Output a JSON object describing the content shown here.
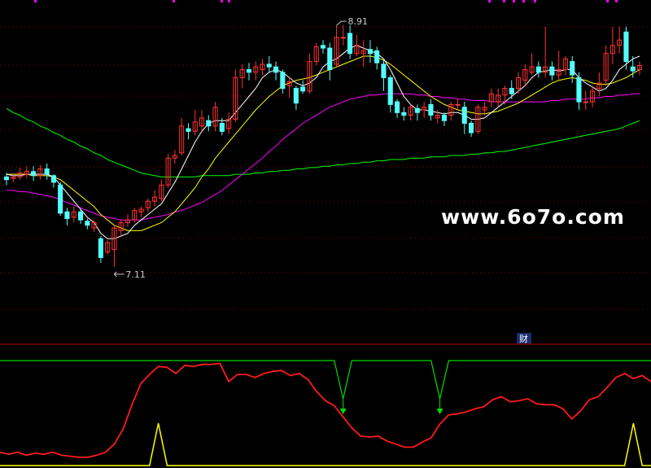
{
  "chart_data": {
    "type": "candlestick",
    "price_range": [
      6.6,
      9.05
    ],
    "high_label": "8.91",
    "low_label": "7.11",
    "watermark": "www.6o7o.com",
    "badge": "财",
    "colors": {
      "background": "#000000",
      "up": "#ff3232",
      "down": "#54ffff",
      "ma_short": "#ffffff",
      "ma_mid": "#ffff00",
      "ma_long": "#ff00ff",
      "ma_longest": "#00ff00",
      "grid": "#8b0000",
      "divider": "#c00000",
      "osc_red": "#ff1a1a",
      "osc_green": "#00dd00",
      "osc_yellow": "#ffff00"
    },
    "candles": [
      [
        7.78,
        7.76,
        7.72,
        7.81
      ],
      [
        7.77,
        7.78,
        7.74,
        7.81
      ],
      [
        7.78,
        7.81,
        7.76,
        7.85
      ],
      [
        7.8,
        7.82,
        7.77,
        7.86
      ],
      [
        7.82,
        7.79,
        7.75,
        7.86
      ],
      [
        7.79,
        7.84,
        7.76,
        7.87
      ],
      [
        7.84,
        7.8,
        7.76,
        7.88
      ],
      [
        7.79,
        7.74,
        7.7,
        7.8
      ],
      [
        7.72,
        7.51,
        7.49,
        7.74
      ],
      [
        7.52,
        7.47,
        7.42,
        7.55
      ],
      [
        7.48,
        7.52,
        7.44,
        7.56
      ],
      [
        7.52,
        7.46,
        7.43,
        7.54
      ],
      [
        7.45,
        7.42,
        7.39,
        7.47
      ],
      [
        7.4,
        7.44,
        7.37,
        7.46
      ],
      [
        7.32,
        7.18,
        7.14,
        7.34
      ],
      [
        7.22,
        7.29,
        7.2,
        7.31
      ],
      [
        7.24,
        7.4,
        7.11,
        7.42
      ],
      [
        7.38,
        7.44,
        7.34,
        7.46
      ],
      [
        7.44,
        7.46,
        7.41,
        7.5
      ],
      [
        7.46,
        7.53,
        7.44,
        7.55
      ],
      [
        7.52,
        7.54,
        7.48,
        7.56
      ],
      [
        7.55,
        7.6,
        7.52,
        7.62
      ],
      [
        7.6,
        7.63,
        7.56,
        7.68
      ],
      [
        7.62,
        7.72,
        7.6,
        7.76
      ],
      [
        7.72,
        7.92,
        7.7,
        7.95
      ],
      [
        7.92,
        7.94,
        7.88,
        7.98
      ],
      [
        7.96,
        8.16,
        7.94,
        8.22
      ],
      [
        8.14,
        8.12,
        8.06,
        8.18
      ],
      [
        8.12,
        8.19,
        8.09,
        8.28
      ],
      [
        8.16,
        8.22,
        8.12,
        8.28
      ],
      [
        8.2,
        8.16,
        8.12,
        8.24
      ],
      [
        8.16,
        8.3,
        8.12,
        8.34
      ],
      [
        8.18,
        8.12,
        8.09,
        8.22
      ],
      [
        8.14,
        8.21,
        8.1,
        8.26
      ],
      [
        8.21,
        8.52,
        8.19,
        8.58
      ],
      [
        8.52,
        8.58,
        8.44,
        8.62
      ],
      [
        8.58,
        8.56,
        8.5,
        8.63
      ],
      [
        8.56,
        8.6,
        8.5,
        8.64
      ],
      [
        8.58,
        8.62,
        8.54,
        8.66
      ],
      [
        8.62,
        8.6,
        8.56,
        8.68
      ],
      [
        8.6,
        8.56,
        8.5,
        8.64
      ],
      [
        8.56,
        8.44,
        8.4,
        8.58
      ],
      [
        8.46,
        8.49,
        8.37,
        8.52
      ],
      [
        8.44,
        8.33,
        8.28,
        8.46
      ],
      [
        8.45,
        8.42,
        8.4,
        8.5
      ],
      [
        8.42,
        8.64,
        8.4,
        8.7
      ],
      [
        8.64,
        8.75,
        8.61,
        8.78
      ],
      [
        8.76,
        8.74,
        8.7,
        8.8
      ],
      [
        8.74,
        8.58,
        8.5,
        8.78
      ],
      [
        8.62,
        8.82,
        8.6,
        8.91
      ],
      [
        8.82,
        8.82,
        8.76,
        8.91
      ],
      [
        8.85,
        8.7,
        8.66,
        8.91
      ],
      [
        8.7,
        8.76,
        8.68,
        8.84
      ],
      [
        8.7,
        8.72,
        8.6,
        8.8
      ],
      [
        8.73,
        8.7,
        8.63,
        8.8
      ],
      [
        8.72,
        8.63,
        8.58,
        8.75
      ],
      [
        8.62,
        8.52,
        8.42,
        8.66
      ],
      [
        8.52,
        8.32,
        8.26,
        8.54
      ],
      [
        8.34,
        8.26,
        8.22,
        8.36
      ],
      [
        8.26,
        8.24,
        8.2,
        8.3
      ],
      [
        8.24,
        8.3,
        8.2,
        8.32
      ],
      [
        8.29,
        8.26,
        8.2,
        8.32
      ],
      [
        8.28,
        8.3,
        8.22,
        8.34
      ],
      [
        8.32,
        8.24,
        8.2,
        8.36
      ],
      [
        8.22,
        8.24,
        8.18,
        8.28
      ],
      [
        8.24,
        8.2,
        8.16,
        8.26
      ],
      [
        8.24,
        8.32,
        8.2,
        8.34
      ],
      [
        8.32,
        8.32,
        8.28,
        8.36
      ],
      [
        8.3,
        8.18,
        8.1,
        8.34
      ],
      [
        8.18,
        8.11,
        8.08,
        8.2
      ],
      [
        8.12,
        8.3,
        8.1,
        8.32
      ],
      [
        8.28,
        8.3,
        8.24,
        8.34
      ],
      [
        8.34,
        8.4,
        8.3,
        8.44
      ],
      [
        8.34,
        8.39,
        8.3,
        8.44
      ],
      [
        8.39,
        8.44,
        8.32,
        8.46
      ],
      [
        8.44,
        8.4,
        8.36,
        8.5
      ],
      [
        8.44,
        8.52,
        8.4,
        8.56
      ],
      [
        8.5,
        8.58,
        8.46,
        8.62
      ],
      [
        8.56,
        8.6,
        8.54,
        8.7
      ],
      [
        8.6,
        8.56,
        8.52,
        8.64
      ],
      [
        8.56,
        8.6,
        8.52,
        8.9
      ],
      [
        8.6,
        8.54,
        8.5,
        8.64
      ],
      [
        8.54,
        8.58,
        8.5,
        8.72
      ],
      [
        8.58,
        8.66,
        8.54,
        8.68
      ],
      [
        8.64,
        8.54,
        8.48,
        8.68
      ],
      [
        8.52,
        8.34,
        8.28,
        8.56
      ],
      [
        8.34,
        8.34,
        8.28,
        8.42
      ],
      [
        8.34,
        8.42,
        8.3,
        8.46
      ],
      [
        8.44,
        8.48,
        8.38,
        8.56
      ],
      [
        8.5,
        8.7,
        8.46,
        8.76
      ],
      [
        8.7,
        8.76,
        8.62,
        8.9
      ],
      [
        8.76,
        8.8,
        8.7,
        8.9
      ],
      [
        8.86,
        8.64,
        8.58,
        8.9
      ],
      [
        8.6,
        8.57,
        8.52,
        8.68
      ],
      [
        8.58,
        8.61,
        8.54,
        8.64
      ]
    ],
    "ma_short": [
      7.8,
      7.79,
      7.79,
      7.8,
      7.8,
      7.8,
      7.8,
      7.78,
      7.72,
      7.66,
      7.6,
      7.54,
      7.48,
      7.44,
      7.36,
      7.32,
      7.32,
      7.34,
      7.36,
      7.42,
      7.46,
      7.5,
      7.54,
      7.58,
      7.66,
      7.74,
      7.84,
      7.94,
      8.04,
      8.12,
      8.18,
      8.2,
      8.2,
      8.2,
      8.26,
      8.32,
      8.38,
      8.44,
      8.52,
      8.56,
      8.58,
      8.56,
      8.52,
      8.48,
      8.46,
      8.48,
      8.52,
      8.6,
      8.64,
      8.66,
      8.7,
      8.74,
      8.76,
      8.74,
      8.72,
      8.7,
      8.66,
      8.58,
      8.48,
      8.38,
      8.32,
      8.28,
      8.28,
      8.27,
      8.26,
      8.25,
      8.26,
      8.26,
      8.24,
      8.21,
      8.21,
      8.22,
      8.26,
      8.3,
      8.34,
      8.38,
      8.42,
      8.46,
      8.52,
      8.56,
      8.57,
      8.58,
      8.57,
      8.58,
      8.58,
      8.52,
      8.48,
      8.45,
      8.42,
      8.44,
      8.5,
      8.58,
      8.62,
      8.66,
      8.68
    ],
    "ma_mid": [
      7.8,
      7.8,
      7.8,
      7.8,
      7.79,
      7.79,
      7.79,
      7.78,
      7.76,
      7.72,
      7.68,
      7.64,
      7.6,
      7.56,
      7.5,
      7.46,
      7.42,
      7.4,
      7.38,
      7.38,
      7.38,
      7.4,
      7.42,
      7.44,
      7.48,
      7.52,
      7.58,
      7.64,
      7.7,
      7.78,
      7.84,
      7.92,
      7.98,
      8.04,
      8.1,
      8.16,
      8.22,
      8.28,
      8.33,
      8.38,
      8.42,
      8.46,
      8.48,
      8.5,
      8.51,
      8.52,
      8.54,
      8.56,
      8.58,
      8.6,
      8.62,
      8.64,
      8.66,
      8.68,
      8.68,
      8.67,
      8.65,
      8.62,
      8.58,
      8.54,
      8.5,
      8.46,
      8.42,
      8.38,
      8.35,
      8.32,
      8.3,
      8.28,
      8.27,
      8.26,
      8.25,
      8.25,
      8.26,
      8.27,
      8.29,
      8.31,
      8.33,
      8.36,
      8.39,
      8.42,
      8.45,
      8.48,
      8.5,
      8.51,
      8.52,
      8.51,
      8.5,
      8.48,
      8.47,
      8.47,
      8.48,
      8.5,
      8.52,
      8.55,
      8.58
    ],
    "ma_long": [
      7.68,
      7.68,
      7.67,
      7.67,
      7.66,
      7.65,
      7.64,
      7.63,
      7.61,
      7.59,
      7.57,
      7.55,
      7.53,
      7.51,
      7.49,
      7.48,
      7.47,
      7.46,
      7.46,
      7.46,
      7.46,
      7.47,
      7.48,
      7.49,
      7.5,
      7.52,
      7.53,
      7.55,
      7.57,
      7.59,
      7.62,
      7.65,
      7.68,
      7.72,
      7.76,
      7.8,
      7.84,
      7.88,
      7.92,
      7.97,
      8.01,
      8.06,
      8.1,
      8.14,
      8.18,
      8.21,
      8.24,
      8.27,
      8.3,
      8.32,
      8.34,
      8.36,
      8.37,
      8.38,
      8.39,
      8.39,
      8.4,
      8.4,
      8.4,
      8.4,
      8.4,
      8.39,
      8.39,
      8.38,
      8.38,
      8.37,
      8.37,
      8.36,
      8.36,
      8.35,
      8.35,
      8.35,
      8.34,
      8.34,
      8.34,
      8.34,
      8.34,
      8.34,
      8.34,
      8.34,
      8.34,
      8.35,
      8.35,
      8.36,
      8.36,
      8.36,
      8.36,
      8.37,
      8.37,
      8.38,
      8.38,
      8.39,
      8.39,
      8.4,
      8.4
    ],
    "ma_longest": [
      8.29,
      8.26,
      8.24,
      8.21,
      8.19,
      8.16,
      8.14,
      8.11,
      8.09,
      8.06,
      8.04,
      8.01,
      7.99,
      7.96,
      7.94,
      7.91,
      7.89,
      7.87,
      7.85,
      7.83,
      7.81,
      7.8,
      7.79,
      7.78,
      7.78,
      7.78,
      7.78,
      7.78,
      7.78,
      7.79,
      7.79,
      7.79,
      7.79,
      7.79,
      7.8,
      7.8,
      7.8,
      7.81,
      7.81,
      7.82,
      7.82,
      7.83,
      7.83,
      7.84,
      7.84,
      7.85,
      7.85,
      7.86,
      7.86,
      7.87,
      7.87,
      7.88,
      7.88,
      7.89,
      7.89,
      7.9,
      7.9,
      7.91,
      7.91,
      7.91,
      7.92,
      7.92,
      7.92,
      7.93,
      7.93,
      7.93,
      7.94,
      7.94,
      7.94,
      7.95,
      7.95,
      7.96,
      7.96,
      7.97,
      7.97,
      7.98,
      7.99,
      8.0,
      8.01,
      8.02,
      8.03,
      8.04,
      8.05,
      8.06,
      8.07,
      8.08,
      8.09,
      8.1,
      8.11,
      8.12,
      8.13,
      8.14,
      8.16,
      8.18,
      8.2
    ],
    "oscillator": {
      "red": [
        10,
        8,
        10,
        7,
        9,
        8,
        10,
        7,
        6,
        5,
        5,
        7,
        10,
        18,
        33,
        57,
        78,
        87,
        95,
        94,
        88,
        96,
        95,
        97,
        97,
        98,
        80,
        87,
        87,
        84,
        88,
        90,
        91,
        86,
        88,
        82,
        70,
        61,
        56,
        45,
        34,
        26,
        25,
        26,
        21,
        18,
        15,
        15,
        20,
        24,
        38,
        47,
        48,
        50,
        53,
        55,
        62,
        65,
        60,
        61,
        63,
        58,
        57,
        57,
        53,
        43,
        51,
        62,
        65,
        74,
        84,
        88,
        83,
        86,
        80
      ],
      "red_range": [
        0,
        100
      ],
      "green": [
        100,
        100,
        100,
        100,
        100,
        100,
        100,
        100,
        100,
        100,
        100,
        100,
        100,
        100,
        100,
        100,
        100,
        100,
        100,
        100,
        100,
        100,
        100,
        100,
        100,
        100,
        100,
        100,
        100,
        100,
        100,
        100,
        100,
        100,
        100,
        100,
        100,
        100,
        100,
        100,
        100,
        100,
        100,
        100,
        100,
        100,
        100,
        100,
        100,
        100,
        100,
        100,
        100,
        100,
        100,
        100,
        100,
        100,
        100,
        100,
        100,
        100,
        100,
        100,
        100,
        100,
        100,
        100,
        100,
        100,
        100,
        100,
        100,
        100,
        100
      ],
      "green_dips": [
        39,
        50
      ],
      "yellow_spikes": [
        18,
        72
      ]
    }
  }
}
